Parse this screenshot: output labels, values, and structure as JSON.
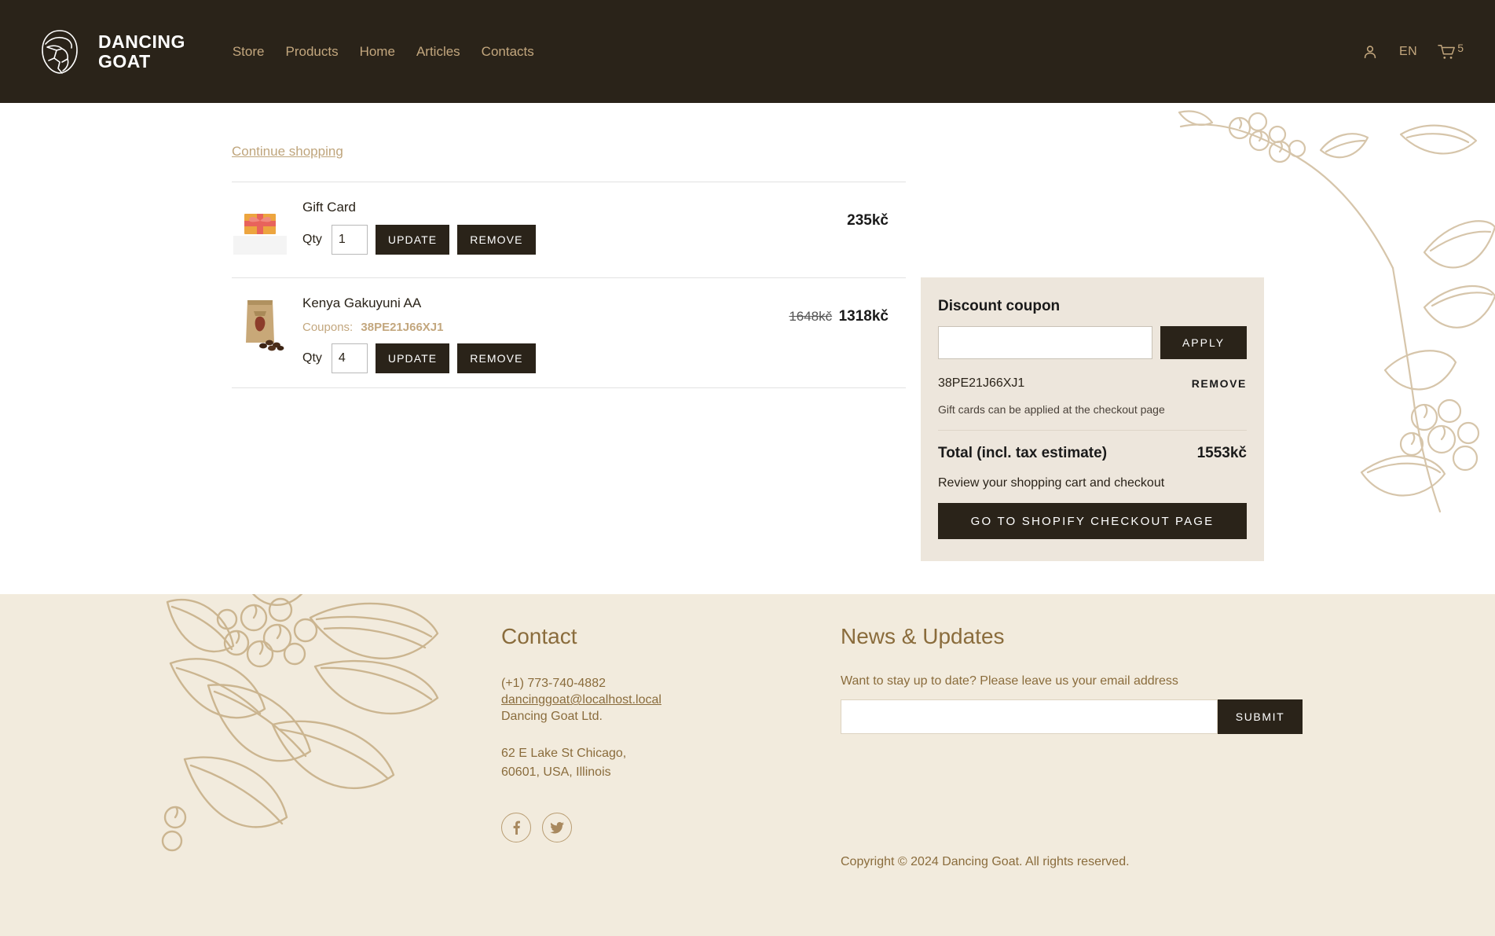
{
  "header": {
    "brand_line1": "DANCING",
    "brand_line2": "GOAT",
    "logo_icon": "goat-head-icon",
    "nav": [
      {
        "label": "Store"
      },
      {
        "label": "Products"
      },
      {
        "label": "Home"
      },
      {
        "label": "Articles"
      },
      {
        "label": "Contacts"
      }
    ],
    "account_icon": "user-icon",
    "language": "EN",
    "cart_icon": "shopping-cart-icon",
    "cart_count": "5"
  },
  "cart": {
    "continue_shopping": "Continue shopping",
    "qty_label": "Qty",
    "update_label": "UPDATE",
    "remove_label": "REMOVE",
    "coupons_label": "Coupons:",
    "items": [
      {
        "name": "Gift Card",
        "image_icon": "gift-card-image",
        "qty": "1",
        "price": "235kč",
        "price_old": "",
        "coupon": ""
      },
      {
        "name": "Kenya Gakuyuni AA",
        "image_icon": "coffee-bag-image",
        "qty": "4",
        "price": "1318kč",
        "price_old": "1648kč",
        "coupon": "38PE21J66XJ1"
      }
    ]
  },
  "summary": {
    "title": "Discount coupon",
    "coupon_placeholder": "",
    "coupon_value": "",
    "apply_label": "APPLY",
    "applied_code": "38PE21J66XJ1",
    "remove_label": "REMOVE",
    "giftcard_note": "Gift cards can be applied at the checkout page",
    "total_label": "Total (incl. tax estimate)",
    "total_value": "1553kč",
    "review_note": "Review your shopping cart and checkout",
    "checkout_label": "GO TO SHOPIFY CHECKOUT PAGE"
  },
  "footer": {
    "contact_heading": "Contact",
    "phone": "(+1) 773-740-4882",
    "email": "dancinggoat@localhost.local",
    "company": "Dancing Goat Ltd.",
    "address_line1": "62 E Lake St Chicago,",
    "address_line2": "60601, USA, Illinois",
    "social": [
      {
        "name": "facebook-icon",
        "glyph": "f"
      },
      {
        "name": "twitter-icon",
        "glyph": "t"
      }
    ],
    "news_heading": "News & Updates",
    "news_sub": "Want to stay up to date? Please leave us your email address",
    "news_placeholder": "",
    "news_value": "",
    "submit_label": "SUBMIT",
    "copyright": "Copyright © 2024 Dancing Goat. All rights reserved."
  },
  "colors": {
    "header_bg": "#2a2319",
    "accent_gold": "#c3a77e",
    "panel_bg": "#ede6dc",
    "footer_bg": "#f2ebdd",
    "footer_text": "#8a6c3c"
  }
}
